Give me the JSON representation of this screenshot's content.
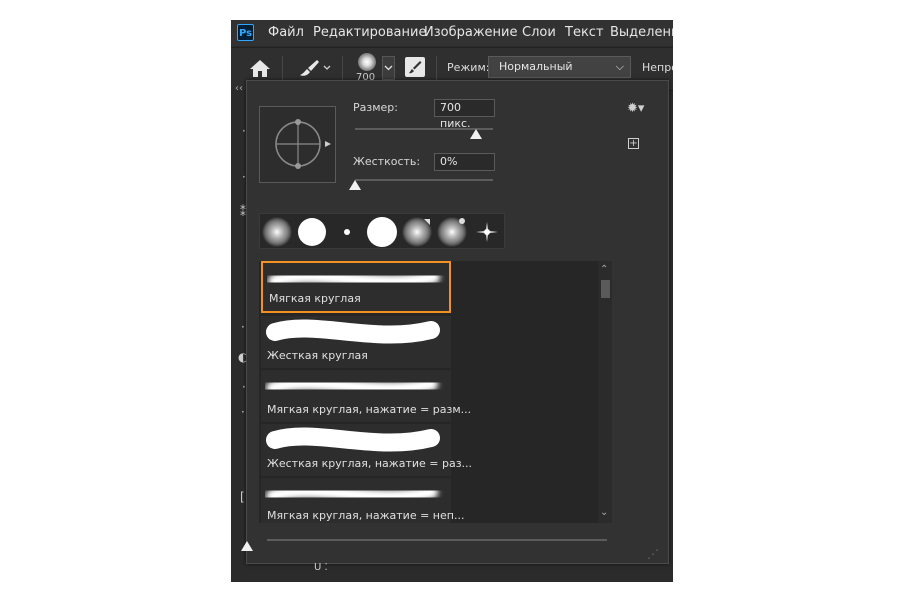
{
  "app": {
    "logo": "Ps"
  },
  "menu": [
    "Файл",
    "Редактирование",
    "Изображение",
    "Слои",
    "Текст",
    "Выделение"
  ],
  "options_bar": {
    "brush_size": "700",
    "mode_label": "Режим:",
    "mode_value": "Нормальный",
    "opacity_label_partial": "Непро"
  },
  "brush_panel": {
    "size_label": "Размер:",
    "size_value": "700 пикс.",
    "size_slider": 0.88,
    "hardness_label": "Жесткость:",
    "hardness_value": "0%",
    "hardness_slider": 0.0,
    "gear_icon": "gear-icon",
    "new_preset_icon": "new-preset-icon",
    "recent_brushes": [
      "soft-round",
      "hard-round",
      "small-hard",
      "hard-round",
      "soft-pressure-size",
      "soft-pressure-opacity",
      "star-sparkle"
    ],
    "brushes": [
      {
        "name": "Мягкая круглая",
        "style": "soft",
        "selected": true
      },
      {
        "name": "Жесткая круглая",
        "style": "hard",
        "selected": false
      },
      {
        "name": "Мягкая круглая, нажатие = разм...",
        "style": "soft",
        "selected": false
      },
      {
        "name": "Жесткая круглая, нажатие = раз...",
        "style": "hard",
        "selected": false
      },
      {
        "name": "Мягкая круглая, нажатие = неп...",
        "style": "soft",
        "selected": false
      }
    ],
    "preview_zoom": 0.3
  },
  "colors": {
    "accent": "#f29121",
    "panel": "#323232",
    "ps_blue": "#31a8ff"
  }
}
